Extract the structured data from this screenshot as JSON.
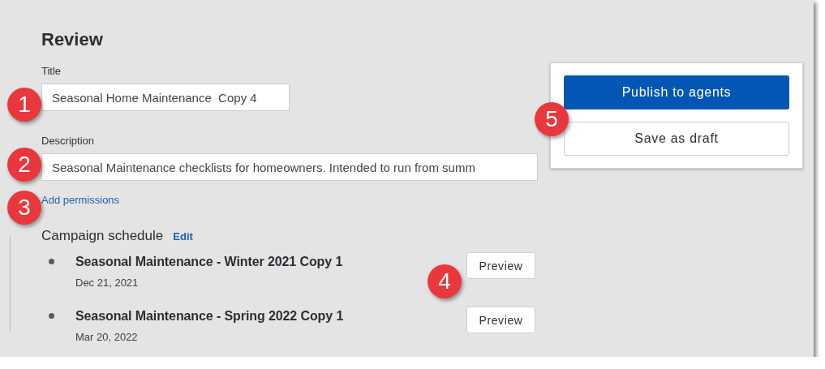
{
  "heading": "Review",
  "title_field": {
    "label": "Title",
    "value": "Seasonal Home Maintenance  Copy 4"
  },
  "description_field": {
    "label": "Description",
    "value": "Seasonal Maintenance checklists for homeowners. Intended to run from summ"
  },
  "permissions_link": "Add permissions",
  "schedule": {
    "title": "Campaign schedule",
    "edit_link": "Edit",
    "items": [
      {
        "name": "Seasonal Maintenance - Winter 2021 Copy 1",
        "date": "Dec 21, 2021",
        "button": "Preview"
      },
      {
        "name": "Seasonal Maintenance - Spring 2022 Copy 1",
        "date": "Mar 20, 2022",
        "button": "Preview"
      }
    ]
  },
  "actions": [
    {
      "label": "Publish to agents",
      "kind": "primary"
    },
    {
      "label": "Save as draft",
      "kind": "secondary"
    }
  ],
  "callouts": [
    "1",
    "2",
    "3",
    "4",
    "5"
  ]
}
